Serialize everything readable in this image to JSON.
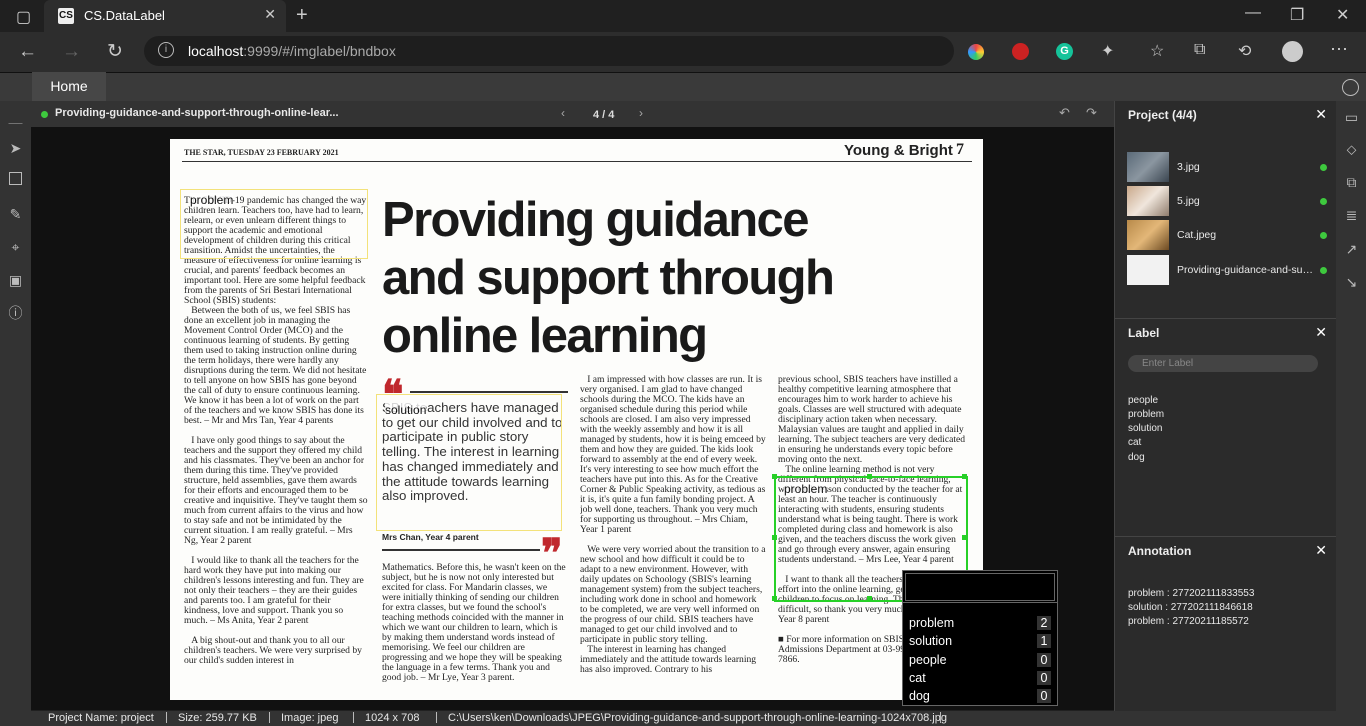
{
  "browser": {
    "tab_title": "CS.DataLabel",
    "tab_icon": "CS",
    "url_host": "localhost",
    "url_rest": ":9999/#/imglabel/bndbox"
  },
  "app": {
    "home_tab": "Home",
    "image_name": "Providing-guidance-and-support-through-online-lear...",
    "image_counter": "4 / 4"
  },
  "newspaper": {
    "masthead_left": "THE STAR, TUESDAY 23 FEBRUARY 2021",
    "masthead_right": "Young & Bright",
    "page_no": "7",
    "headline": [
      "Providing guidance",
      "and support through",
      "online learning"
    ],
    "col1": "The COVID-19 pandemic has changed the way children learn. Teachers too, have had to learn, relearn, or even unlearn different things to support the academic and emotional development of children during this critical transition. Amidst the uncertainties, the measure of effectiveness for online learning is crucial, and parents' feedback becomes an important tool. Here are some helpful feedback from the parents of Sri Bestari International School (SBIS) students:\n   Between the both of us, we feel SBIS has done an excellent job in managing the Movement Control Order (MCO) and the continuous learning of students. By getting them used to taking instruction online during the term holidays, there were hardly any disruptions during the term. We did not hesitate to tell anyone on how SBIS has gone beyond the call of duty to ensure continuous learning. We know it has been a lot of work on the part of the teachers and we know SBIS has done its best. – Mr and Mrs Tan, Year 4 parents\n\n   I have only good things to say about the teachers and the support they offered my child and his classmates. They've been an anchor for them during this time. They've provided structure, held assemblies, gave them awards for their efforts and encouraged them to be creative and inquisitive. They've taught them so much from current affairs to the virus and how to stay safe and not be intimidated by the current situation. I am really grateful. – Mrs Ng, Year 2 parent\n\n   I would like to thank all the teachers for the hard work they have put into making our children's lessons interesting and fun. They are not only their teachers – they are their guides and parents too. I am grateful for their kindness, love and support. Thank you so much. – Ms Anita, Year 2 parent\n\n   A big shout-out and thank you to all our children's teachers. We were very surprised by our child's sudden interest in",
    "quote": "SBIS teachers have managed to get our child involved and to participate in public story telling. The interest in learning has changed immediately and the attitude towards learning also improved.",
    "quote_attrib": "Mrs Chan, Year 4 parent",
    "col2b": "Mathematics. Before this, he wasn't keen on the subject, but he is now not only interested but excited for class. For Mandarin classes, we were initially thinking of sending our children for extra classes, but we found the school's teaching methods coincided with the manner in which we want our children to learn, which is by making them understand words instead of memorising. We feel our children are progressing and we hope they will be speaking the language in a few terms. Thank you and good job. – Mr Lye, Year 3 parent.",
    "col3": "   I am impressed with how classes are run. It is very organised. I am glad to have changed schools during the MCO. The kids have an organised schedule during this period while schools are closed. I am also very impressed with the weekly assembly and how it is all managed by students, how it is being emceed by them and how they are guided. The kids look forward to assembly at the end of every week. It's very interesting to see how much effort the teachers have put into this. As for the Creative Corner & Public Speaking activity, as tedious as it is, it's quite a fun family bonding project. A job well done, teachers. Thank you very much for supporting us throughout. – Mrs Chiam, Year 1 parent\n\n   We were very worried about the transition to a new school and how difficult it could be to adapt to a new environment. However, with daily updates on Schoology (SBIS's learning management system) from the subject teachers, including work done in school and homework to be completed, we are very well informed on the progress of our child. SBIS teachers have managed to get our child involved and to participate in public story telling.\n   The interest in learning has changed immediately and the attitude towards learning has also improved. Contrary to his",
    "col4": "previous school, SBIS teachers have instilled a healthy competitive learning atmosphere that encourages him to work harder to achieve his goals. Classes are well structured with adequate disciplinary action taken when necessary. Malaysian values are taught and applied in daily learning. The subject teachers are very dedicated in ensuring he understands every topic before moving onto the next.\n   The online learning method is not very different from physical face-to-face learning, with each lesson conducted by the teacher for at least an hour. The teacher is continuously interacting with students, ensuring students understand what is being taught. There is work completed during class and homework is also given, and the teachers discuss the work given and go through every answer, again ensuring students understand. – Mrs Lee, Year 4 parent\n\n   I want to thank all the teachers for so much effort into the online learning, getting the children to focus on learning. This is the most difficult, so thank you very much. – Mrs Hon, Year 8 parent\n\n■ For more information on SBIS, call the Admissions Department at 03-9923 or 011-5139 7866."
  },
  "annotations_on_image": [
    {
      "label": "problem"
    },
    {
      "label": "solution"
    },
    {
      "label": "problem"
    }
  ],
  "label_popup": {
    "items": [
      {
        "name": "problem",
        "count": "2"
      },
      {
        "name": "solution",
        "count": "1"
      },
      {
        "name": "people",
        "count": "0"
      },
      {
        "name": "cat",
        "count": "0"
      },
      {
        "name": "dog",
        "count": "0"
      }
    ]
  },
  "project_panel": {
    "title": "Project (4/4)",
    "files": [
      {
        "name": "3.jpg"
      },
      {
        "name": "5.jpg"
      },
      {
        "name": "Cat.jpeg"
      },
      {
        "name": "Providing-guidance-and-support-through-online-learning-1024x708.jpg"
      }
    ]
  },
  "label_panel": {
    "title": "Label",
    "placeholder": "Enter Label",
    "labels": [
      "people",
      "problem",
      "solution",
      "cat",
      "dog"
    ]
  },
  "annotation_panel": {
    "title": "Annotation",
    "items": [
      "problem : 277202111833553",
      "solution : 277202111846618",
      "problem : 27720211185572"
    ]
  },
  "status": {
    "project": "Project Name: project",
    "size": "Size: 259.77 KB",
    "image": "Image: jpeg",
    "dims": "1024 x 708",
    "path": "C:\\Users\\ken\\Downloads\\JPEG\\Providing-guidance-and-support-through-online-learning-1024x708.jpg"
  },
  "colors": {
    "selected_box": "#27d027",
    "box": "#f3e27a",
    "status_dot": "#3ec93e"
  }
}
